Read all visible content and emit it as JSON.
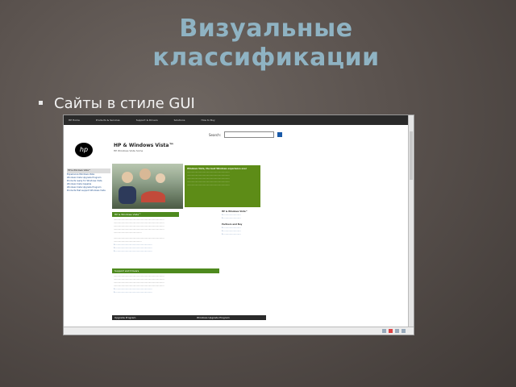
{
  "slide": {
    "title_line1": "Визуальные",
    "title_line2": "классификации",
    "bullet": "Сайты в стиле GUI"
  },
  "screenshot": {
    "nav": [
      "HP Home",
      "Products & Services",
      "Support & Drivers",
      "Solutions",
      "How to Buy"
    ],
    "search_label": "Search:",
    "heading": "HP & Windows Vista™",
    "subheading": "HP Windows Vista home",
    "left_nav_header": "HP & Windows Vista™",
    "left_nav": [
      "Experience Windows Vista",
      "Windows Vista Upgrade Program",
      "Products ready for Windows Vista",
      "Windows Vista Capable",
      "Windows Vista Upgrade Program",
      "Products that support Windows Vista"
    ],
    "green_box_title": "Windows Vista, the best Windows experience ever",
    "section1": "HP & Windows Vista™",
    "section2": "Support and Drivers",
    "section3": "Upgrade Program",
    "section4": "Windows Upgrade Program",
    "right_col_title": "HP & Windows Vista™",
    "right_col_title2": "Partners and Buy",
    "logo_text": "hp",
    "colors": {
      "nav_bg": "#2a2a2a",
      "hp_green": "#5d8c17",
      "title_blue": "#8fb3c3"
    }
  }
}
